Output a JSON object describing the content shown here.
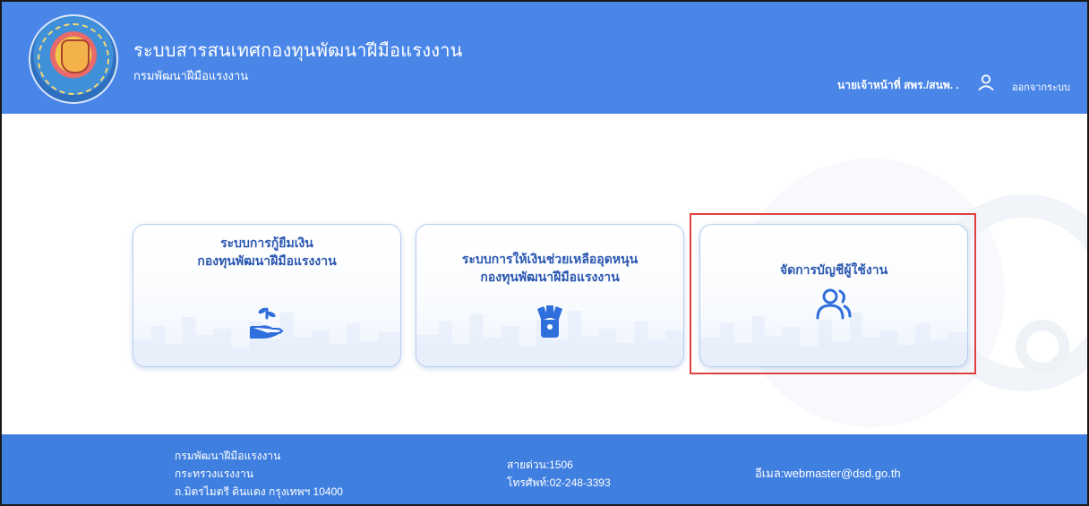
{
  "header": {
    "title": "ระบบสารสนเทศกองทุนพัฒนาฝีมือแรงงาน",
    "subtitle": "กรมพัฒนาฝีมือแรงงาน",
    "user_name": "นายเจ้าหน้าที่ สพร./สนพ. .",
    "logout_label": "ออกจากระบบ",
    "logo_icon": "department-seal-logo",
    "user_icon": "user-icon"
  },
  "cards": [
    {
      "line1": "ระบบการกู้ยืมเงิน",
      "line2": "กองทุนพัฒนาฝีมือแรงงาน",
      "icon": "hand-seedling-icon"
    },
    {
      "line1": "ระบบการให้เงินช่วยเหลืออุดหนุน",
      "line2": "กองทุนพัฒนาฝีมือแรงงาน",
      "icon": "money-hand-icon"
    },
    {
      "line1": "จัดการบัญชีผู้ใช้งาน",
      "line2": "",
      "icon": "users-icon"
    }
  ],
  "footer": {
    "org_name": "กรมพัฒนาฝีมือแรงงาน",
    "ministry": "กระทรวงแรงงาน",
    "address": "ถ.มิตรไมตรี ดินแดง กรุงเทพฯ 10400",
    "hotline": "สายด่วน:1506",
    "phone": "โทรศัพท์:02-248-3393",
    "email": "อีเมล:webmaster@dsd.go.th"
  },
  "colors": {
    "header_bg": "#4a86e8",
    "footer_bg": "#3f7fe0",
    "card_text": "#2a57b0",
    "highlight": "#e0413f"
  }
}
